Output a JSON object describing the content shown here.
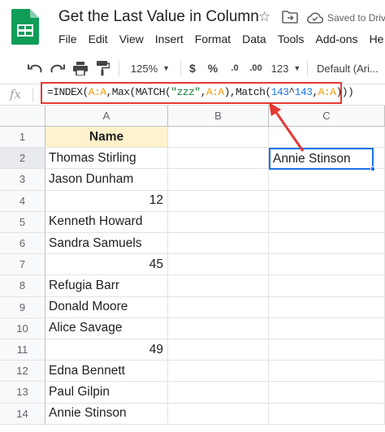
{
  "app": {
    "title": "Get the Last Value in Column",
    "saved_status": "Saved to Driv",
    "brand_color": "#0f9d58"
  },
  "menu": [
    "File",
    "Edit",
    "View",
    "Insert",
    "Format",
    "Data",
    "Tools",
    "Add-ons",
    "He"
  ],
  "toolbar": {
    "zoom": "125%",
    "currency": "$",
    "percent": "%",
    "decrease_decimal": ".0",
    "increase_decimal": ".00",
    "more_formats": "123",
    "font": "Default (Ari..."
  },
  "formula_bar": {
    "fx_label": "fx",
    "parts": [
      {
        "t": "=INDEX(",
        "c": ""
      },
      {
        "t": "A:A",
        "c": "ref"
      },
      {
        "t": ",Max(MATCH(",
        "c": ""
      },
      {
        "t": "\"zzz\"",
        "c": "str"
      },
      {
        "t": ",",
        "c": ""
      },
      {
        "t": "A:A",
        "c": "ref"
      },
      {
        "t": "),Match(",
        "c": ""
      },
      {
        "t": "143",
        "c": "num"
      },
      {
        "t": "^",
        "c": ""
      },
      {
        "t": "143",
        "c": "num"
      },
      {
        "t": ",",
        "c": ""
      },
      {
        "t": "A:A",
        "c": "ref"
      },
      {
        "t": ")))",
        "c": ""
      }
    ],
    "highlight_color": "#e53935"
  },
  "sheet": {
    "columns": [
      "A",
      "B",
      "C"
    ],
    "rows": [
      {
        "n": "1",
        "a": "Name",
        "type": "header"
      },
      {
        "n": "2",
        "a": "Thomas Stirling",
        "type": "text"
      },
      {
        "n": "3",
        "a": "Jason Dunham",
        "type": "text"
      },
      {
        "n": "4",
        "a": "12",
        "type": "number"
      },
      {
        "n": "5",
        "a": "Kenneth Howard",
        "type": "text"
      },
      {
        "n": "6",
        "a": "Sandra Samuels",
        "type": "text"
      },
      {
        "n": "7",
        "a": "45",
        "type": "number"
      },
      {
        "n": "8",
        "a": "Refugia Barr",
        "type": "text"
      },
      {
        "n": "9",
        "a": "Donald Moore",
        "type": "text"
      },
      {
        "n": "10",
        "a": "Alice Savage",
        "type": "text"
      },
      {
        "n": "11",
        "a": "49",
        "type": "number"
      },
      {
        "n": "12",
        "a": "Edna Bennett",
        "type": "text"
      },
      {
        "n": "13",
        "a": "Paul Gilpin",
        "type": "text"
      },
      {
        "n": "14",
        "a": "Annie Stinson",
        "type": "text"
      }
    ],
    "selected_cell": {
      "ref": "C2",
      "value": "Annie Stinson"
    },
    "header_fill": "#fff2cc",
    "selection_color": "#1a73e8"
  }
}
